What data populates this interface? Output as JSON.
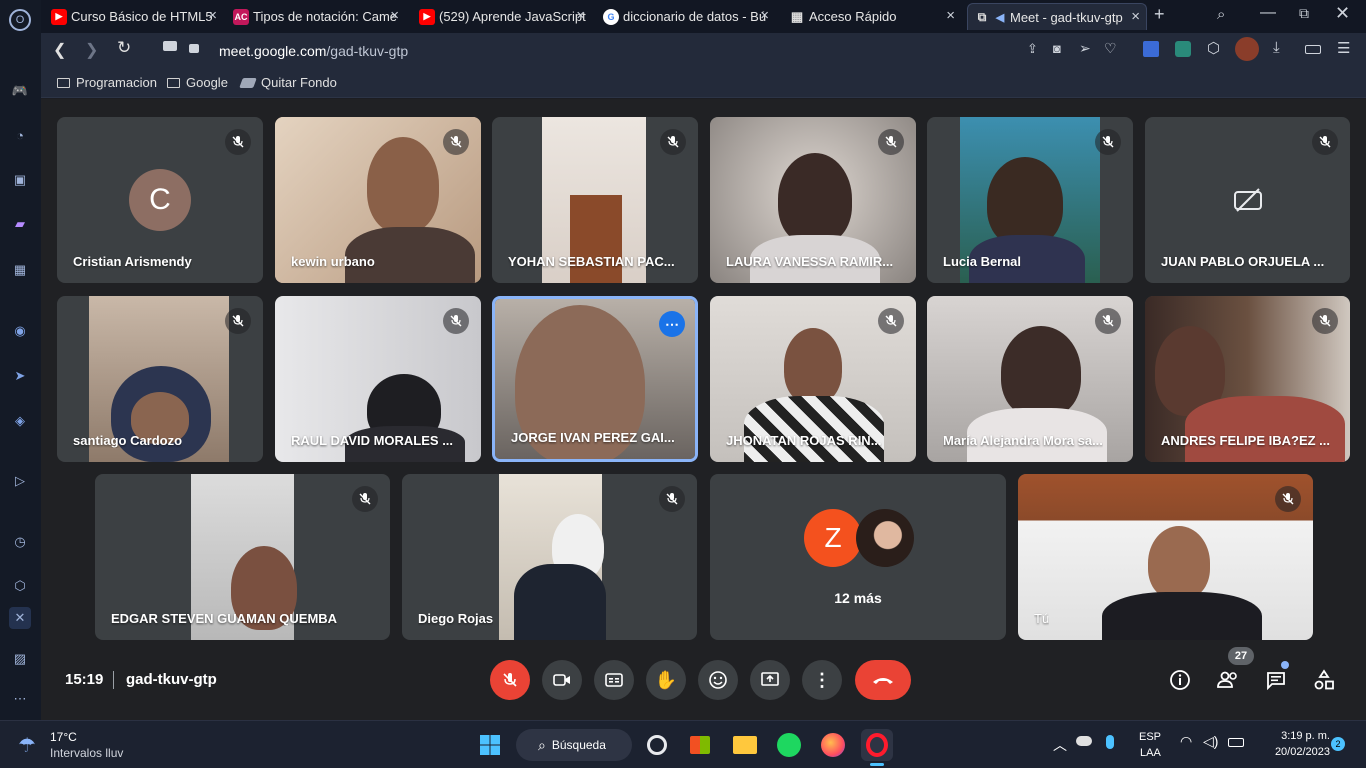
{
  "browser": {
    "tabs": [
      {
        "label": "Curso Básico de HTML5"
      },
      {
        "label": "Tipos de notación: Came"
      },
      {
        "label": "(529) Aprende JavaScript"
      },
      {
        "label": "diccionario de datos - Bú"
      },
      {
        "label": "Acceso Rápido"
      },
      {
        "label": "Meet - gad-tkuv-gtp"
      }
    ],
    "url_host": "meet.google.com",
    "url_path": "/gad-tkuv-gtp",
    "bookmarks": [
      "Programacion",
      "Google",
      "Quitar Fondo"
    ]
  },
  "meet": {
    "participants": [
      {
        "name": "Cristian Arismendy",
        "initial": "C"
      },
      {
        "name": "kewin urbano"
      },
      {
        "name": "YOHAN SEBASTIAN PAC..."
      },
      {
        "name": "LAURA VANESSA RAMIR..."
      },
      {
        "name": "Lucia Bernal"
      },
      {
        "name": "JUAN PABLO ORJUELA ..."
      },
      {
        "name": "santiago Cardozo"
      },
      {
        "name": "RAUL DAVID MORALES ..."
      },
      {
        "name": "JORGE IVAN PEREZ GAI..."
      },
      {
        "name": "JHONATAN ROJAS RIN..."
      },
      {
        "name": "María Alejandra Mora sa..."
      },
      {
        "name": "ANDRES FELIPE IBA?EZ ..."
      },
      {
        "name": "EDGAR STEVEN GUAMAN QUEMBA"
      },
      {
        "name": "Diego Rojas"
      },
      {
        "name": "Tú"
      }
    ],
    "more_tile": {
      "initial": "Z",
      "label": "12 más"
    },
    "time": "15:19",
    "meeting_code": "gad-tkuv-gtp",
    "participant_count": "27",
    "accent_red": "#ea4335",
    "accent_blue": "#8ab4f8"
  },
  "taskbar": {
    "weather_temp": "17°C",
    "weather_desc": "Intervalos lluv",
    "search_label": "Búsqueda",
    "lang_top": "ESP",
    "lang_bottom": "LAA",
    "clock_time": "3:19 p. m.",
    "clock_date": "20/02/2023",
    "notif_count": "2"
  }
}
